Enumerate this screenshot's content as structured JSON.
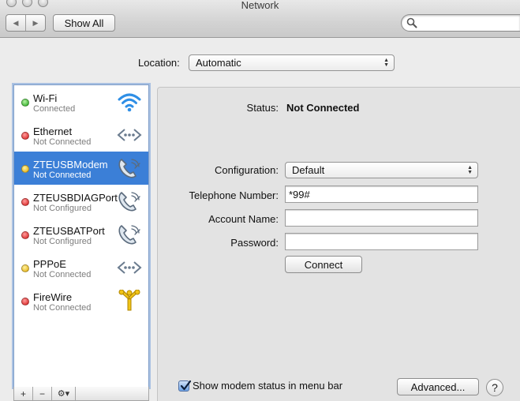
{
  "window": {
    "title": "Network",
    "nav_back_icon": "back-icon",
    "nav_forward_icon": "forward-icon",
    "show_all_label": "Show All",
    "search_value": ""
  },
  "location": {
    "label": "Location:",
    "value": "Automatic"
  },
  "services": [
    {
      "name": "Wi-Fi",
      "status": "Connected",
      "dot": "green",
      "icon": "wifi-icon",
      "selected": false
    },
    {
      "name": "Ethernet",
      "status": "Not Connected",
      "dot": "red",
      "icon": "ethernet-icon",
      "selected": false
    },
    {
      "name": "ZTEUSBModem",
      "status": "Not Connected",
      "dot": "yellow",
      "icon": "phone-modem-icon",
      "selected": true
    },
    {
      "name": "ZTEUSBDIAGPort",
      "status": "Not Configured",
      "dot": "red",
      "icon": "phone-modem-icon",
      "selected": false
    },
    {
      "name": "ZTEUSBATPort",
      "status": "Not Configured",
      "dot": "red",
      "icon": "phone-modem-icon",
      "selected": false
    },
    {
      "name": "PPPoE",
      "status": "Not Connected",
      "dot": "yellow",
      "icon": "ethernet-icon",
      "selected": false
    },
    {
      "name": "FireWire",
      "status": "Not Connected",
      "dot": "red",
      "icon": "firewire-icon",
      "selected": false
    }
  ],
  "sidebar_tools": {
    "add": "+",
    "remove": "−",
    "action_icon": "gear-icon"
  },
  "detail": {
    "status_label": "Status:",
    "status_value": "Not Connected",
    "configuration_label": "Configuration:",
    "configuration_value": "Default",
    "telephone_label": "Telephone Number:",
    "telephone_value": "*99#",
    "account_label": "Account Name:",
    "account_value": "",
    "password_label": "Password:",
    "password_value": "",
    "connect_label": "Connect",
    "show_status_label": "Show modem status in menu bar",
    "show_status_checked": true,
    "advanced_label": "Advanced...",
    "help_label": "?"
  },
  "colors": {
    "selection": "#3b7fd7",
    "status_green": "#1fa516",
    "status_red": "#d41515",
    "status_yellow": "#e0a800"
  }
}
